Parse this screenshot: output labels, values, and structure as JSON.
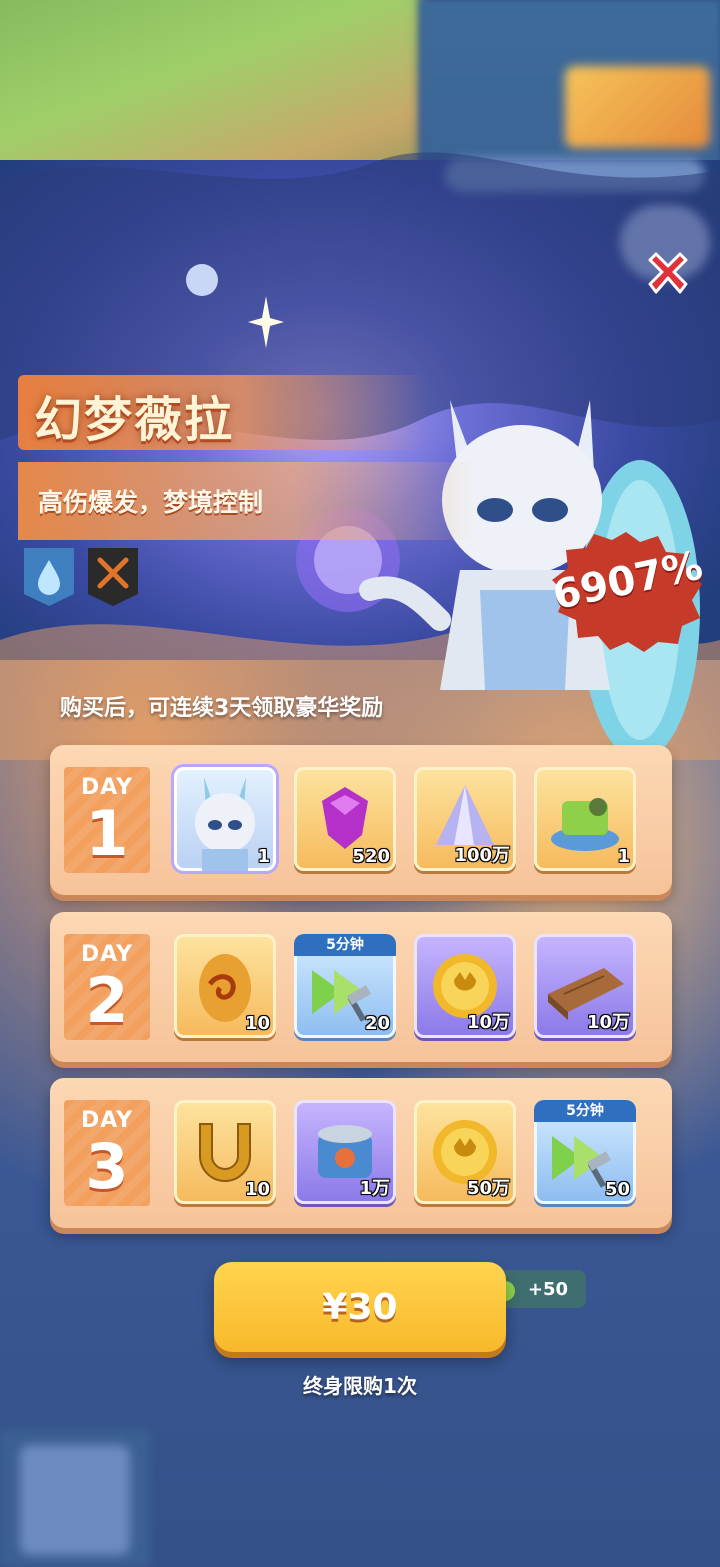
{
  "hero": {
    "name": "幻梦薇拉",
    "subtitle": "高伤爆发，梦境控制",
    "badges": [
      "water-drop-icon",
      "crossed-swords-icon"
    ],
    "value_percent": "6907%"
  },
  "rewards_caption": "购买后，可连续3天领取豪华奖励",
  "days": [
    {
      "day_word": "DAY",
      "day_number": "1",
      "items": [
        {
          "icon": "hero-portrait-icon",
          "count": "1"
        },
        {
          "icon": "purple-gem-icon",
          "count": "520"
        },
        {
          "icon": "crystal-shard-icon",
          "count": "100万"
        },
        {
          "icon": "green-machine-icon",
          "count": "1"
        }
      ]
    },
    {
      "day_word": "DAY",
      "day_number": "2",
      "items": [
        {
          "icon": "swirl-egg-icon",
          "count": "10"
        },
        {
          "icon": "speedup-hammer-icon",
          "count": "20",
          "top_label": "5分钟"
        },
        {
          "icon": "gold-coin-icon",
          "count": "10万"
        },
        {
          "icon": "wood-plank-icon",
          "count": "10万"
        }
      ]
    },
    {
      "day_word": "DAY",
      "day_number": "3",
      "items": [
        {
          "icon": "golden-horseshoe-icon",
          "count": "10"
        },
        {
          "icon": "pet-food-can-icon",
          "count": "1万"
        },
        {
          "icon": "gold-coin-icon",
          "count": "50万"
        },
        {
          "icon": "speedup-hammer-icon",
          "count": "50",
          "top_label": "5分钟"
        }
      ]
    }
  ],
  "purchase": {
    "price": "¥30",
    "bonus": "+50",
    "limit_note": "终身限购1次"
  },
  "colors": {
    "accent_orange": "#f39f5e",
    "button_yellow": "#f8b92a",
    "seal_red": "#c63a2a",
    "close_red": "#e0323a"
  }
}
